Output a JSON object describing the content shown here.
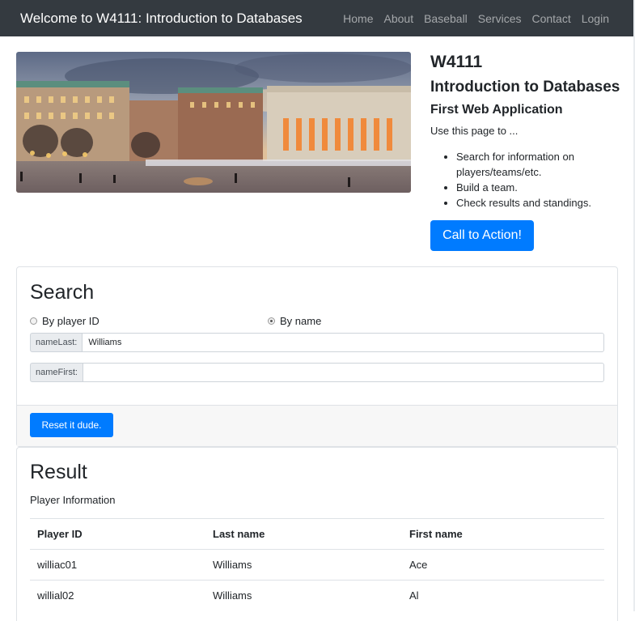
{
  "navbar": {
    "brand": "Welcome to W4111: Introduction to Databases",
    "links": [
      "Home",
      "About",
      "Baseball",
      "Services",
      "Contact",
      "Login"
    ]
  },
  "hero": {
    "course_code": "W4111",
    "course_title": "Introduction to Databases",
    "subtitle": "First Web Application",
    "lead": "Use this page to ...",
    "features": [
      "Search for information on players/teams/etc.",
      "Build a team.",
      "Check results and standings."
    ],
    "cta_label": "Call to Action!",
    "image": "campus-photo"
  },
  "search": {
    "heading": "Search",
    "radio_options": [
      {
        "label": "By player ID",
        "checked": false
      },
      {
        "label": "By name",
        "checked": true
      }
    ],
    "fields": [
      {
        "label": "nameLast:",
        "value": "Williams",
        "placeholder": ""
      },
      {
        "label": "nameFirst:",
        "value": "",
        "placeholder": ""
      }
    ],
    "reset_label": "Reset it dude."
  },
  "result": {
    "heading": "Result",
    "caption": "Player Information",
    "columns": [
      "Player ID",
      "Last name",
      "First name"
    ],
    "rows": [
      [
        "williac01",
        "Williams",
        "Ace"
      ],
      [
        "willial02",
        "Williams",
        "Al"
      ]
    ]
  },
  "colors": {
    "navbar_bg": "#343a40",
    "primary": "#007bff"
  }
}
